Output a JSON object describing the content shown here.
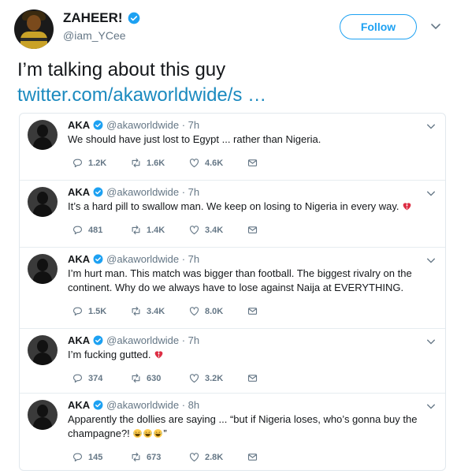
{
  "tweet": {
    "name": "ZAHEER!",
    "handle": "@iam_YCee",
    "follow_label": "Follow",
    "text": "I’m talking about this guy",
    "link": "twitter.com/akaworldwide/s …"
  },
  "quoted": [
    {
      "name": "AKA",
      "meta": "@akaworldwide · 7h",
      "text": "We should have just lost to Egypt ... rather than Nigeria.",
      "emoji": "",
      "replies": "1.2K",
      "retweets": "1.6K",
      "likes": "4.6K"
    },
    {
      "name": "AKA",
      "meta": "@akaworldwide · 7h",
      "text": "It’s a hard pill to swallow man. We keep on losing to Nigeria in every way.",
      "emoji": "broken-heart",
      "replies": "481",
      "retweets": "1.4K",
      "likes": "3.4K"
    },
    {
      "name": "AKA",
      "meta": "@akaworldwide · 7h",
      "text": "I’m hurt man. This match was bigger than football. The biggest rivalry on the continent. Why do we always have to lose against Naija at EVERYTHING.",
      "emoji": "",
      "replies": "1.5K",
      "retweets": "3.4K",
      "likes": "8.0K"
    },
    {
      "name": "AKA",
      "meta": "@akaworldwide · 7h",
      "text": "I’m fucking gutted.",
      "emoji": "broken-heart",
      "replies": "374",
      "retweets": "630",
      "likes": "3.2K"
    },
    {
      "name": "AKA",
      "meta": "@akaworldwide · 8h",
      "text": "Apparently the dollies are saying ... “but if Nigeria loses, who’s gonna buy the champagne?!",
      "emoji": "laughing-tears",
      "text_end": "”",
      "replies": "145",
      "retweets": "673",
      "likes": "2.8K"
    }
  ],
  "colors": {
    "accent": "#1da1f2",
    "link": "#1b8abf",
    "muted": "#657786",
    "text": "#14171a"
  }
}
